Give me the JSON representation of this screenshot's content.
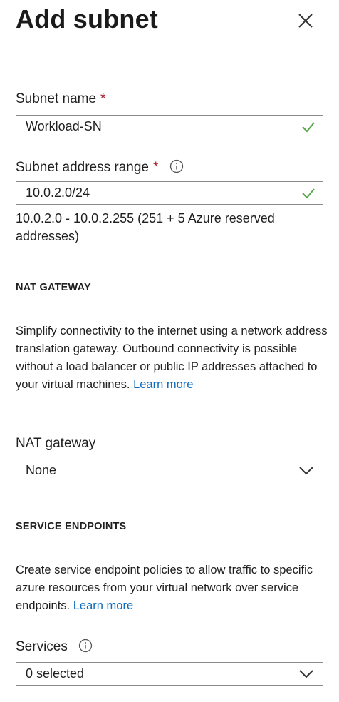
{
  "panel": {
    "title": "Add subnet"
  },
  "subnet_name": {
    "label": "Subnet name",
    "required_mark": "*",
    "value": "Workload-SN"
  },
  "subnet_range": {
    "label": "Subnet address range",
    "required_mark": "*",
    "value": "10.0.2.0/24",
    "helper": "10.0.2.0 - 10.0.2.255 (251 + 5 Azure reserved addresses)"
  },
  "nat_section": {
    "heading": "NAT GATEWAY",
    "description": "Simplify connectivity to the internet using a network address translation gateway. Outbound connectivity is possible without a load balancer or public IP addresses attached to your virtual machines.",
    "learn_more": "Learn more"
  },
  "nat_gateway": {
    "label": "NAT gateway",
    "selected": "None"
  },
  "service_section": {
    "heading": "SERVICE ENDPOINTS",
    "description": "Create service endpoint policies to allow traffic to specific azure resources from your virtual network over service endpoints.",
    "learn_more": "Learn more"
  },
  "services": {
    "label": "Services",
    "selected": "0 selected"
  },
  "colors": {
    "valid_check": "#57a64a",
    "link": "#0f6cbd",
    "required": "#a4262c"
  }
}
